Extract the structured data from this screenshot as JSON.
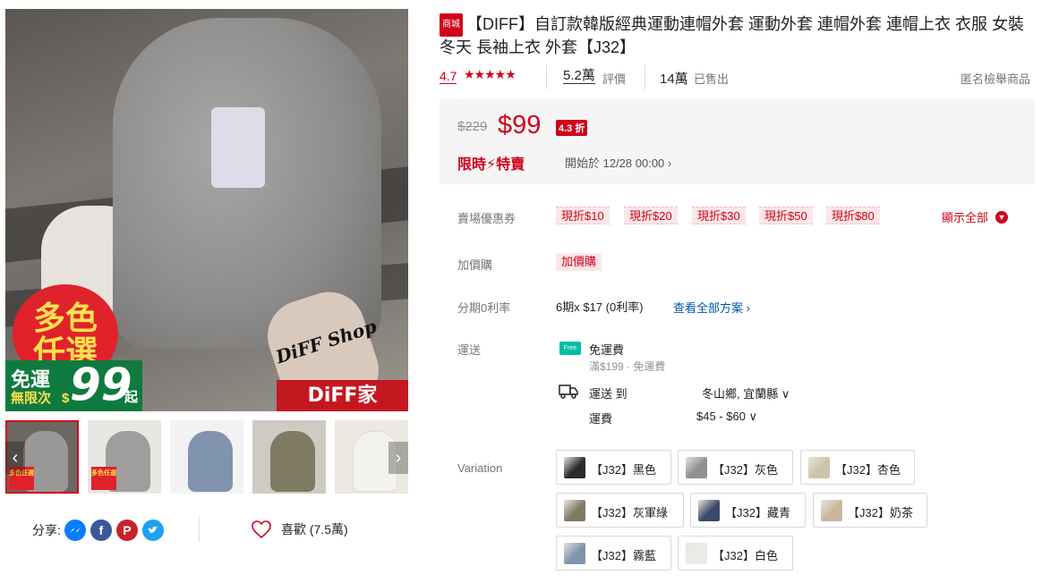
{
  "gallery": {
    "promo": {
      "multi_color": "多色",
      "choice": "任選",
      "free_ship": "免運",
      "unlimited": "無限次",
      "dollar": "$",
      "price": "99",
      "from": "起",
      "brand_band": "DiFF家",
      "script": "DiFF Shop"
    },
    "thumb_tag": "多色任選",
    "prev": "‹",
    "next": "›",
    "share_label": "分享:",
    "share_icons": [
      "messenger-icon",
      "facebook-icon",
      "pinterest-icon",
      "twitter-icon"
    ],
    "like_label": "喜歡 (7.5萬)"
  },
  "product": {
    "mall_badge": "商城",
    "title": "【DIFF】自訂款韓版經典運動連帽外套 運動外套 連帽外套 連帽上衣 衣服 女裝 冬天 長袖上衣 外套【J32】",
    "rating": "4.7",
    "stars": "★★★★★",
    "reviews_count": "5.2萬",
    "reviews_label": "評價",
    "sold_count": "14萬",
    "sold_label": "已售出",
    "anonymous": "匿名檢舉商品"
  },
  "price": {
    "original": "$229",
    "current": "$99",
    "discount": "4.3 折",
    "flash_label": "限時⚡特賣",
    "flash_start": "開始於 12/28 00:00  ›"
  },
  "vouchers": {
    "label": "賣場優惠券",
    "items": [
      "現折$10",
      "現折$20",
      "現折$30",
      "現折$50",
      "現折$80"
    ],
    "show_all": "顯示全部"
  },
  "addon": {
    "label": "加價購",
    "tag": "加價購"
  },
  "installment": {
    "label": "分期0利率",
    "value": "6期x $17 (0利率)",
    "link": "查看全部方案 ›"
  },
  "shipping": {
    "label": "運送",
    "free_icon": "Free",
    "free_title": "免運費",
    "free_sub": "滿$199 · 免運費",
    "ship_to_label": "運送 到",
    "ship_to_value": "冬山鄉, 宜蘭縣 ∨",
    "fee_label": "運費",
    "fee_value": "$45 - $60 ∨"
  },
  "variation": {
    "label": "Variation",
    "options": [
      "【J32】黑色",
      "【J32】灰色",
      "【J32】杏色",
      "【J32】灰軍綠",
      "【J32】藏青",
      "【J32】奶茶",
      "【J32】霧藍",
      "【J32】白色"
    ],
    "swatch_colors": [
      "#2b2b2b",
      "#8f8f8f",
      "#cfc2ad",
      "#7f7a62",
      "#3a4a66",
      "#c9b79c",
      "#7f93ad",
      "#ecebe7"
    ]
  },
  "colors": {
    "accent": "#d0011b",
    "link": "#0055aa",
    "free_ship": "#00bfa5"
  }
}
